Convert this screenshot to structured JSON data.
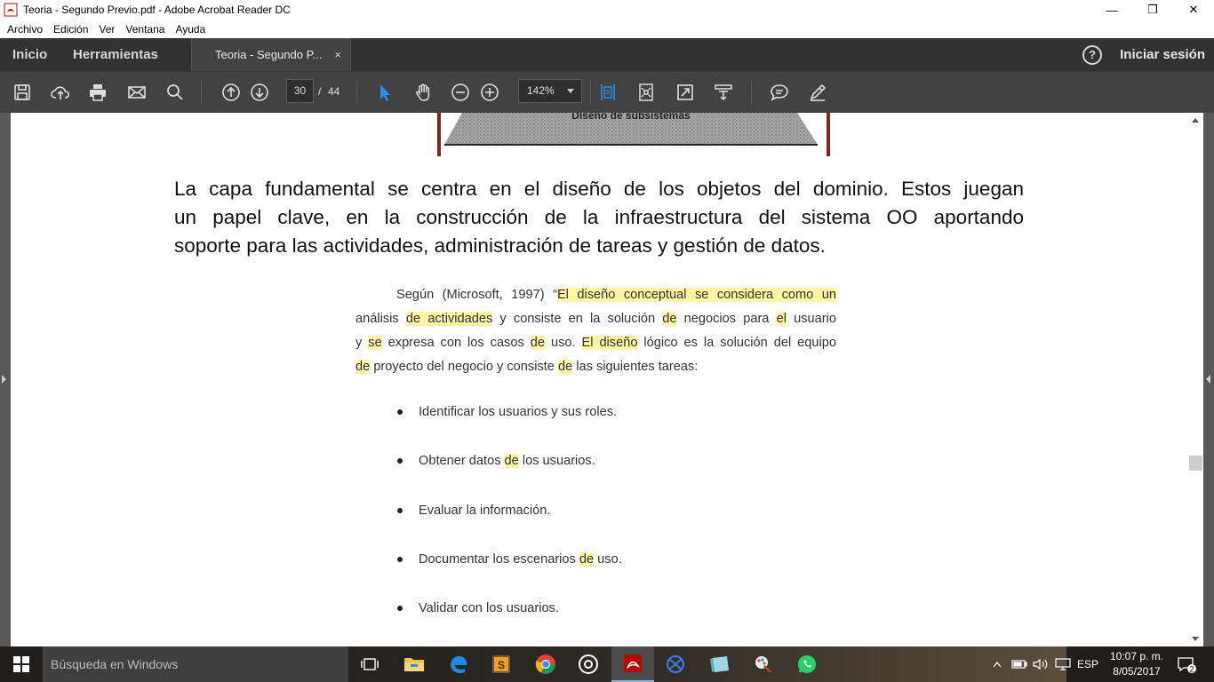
{
  "window": {
    "title": "Teoria - Segundo Previo.pdf - Adobe Acrobat Reader DC",
    "minimize_glyph": "—",
    "maximize_glyph": "❐",
    "close_glyph": "✕"
  },
  "menubar": [
    "Archivo",
    "Edición",
    "Ver",
    "Ventana",
    "Ayuda"
  ],
  "tabs": {
    "home": "Inicio",
    "tools": "Herramientas",
    "document": "Teoria - Segundo P...",
    "document_close": "×",
    "help": "?",
    "signin": "Iniciar sesión"
  },
  "toolbar": {
    "page_current": "30",
    "page_separator": "/",
    "page_total": "44",
    "zoom": "142%",
    "icons": [
      "save-icon",
      "upload-cloud-icon",
      "print-icon",
      "mail-icon",
      "search-icon",
      "page-up-icon",
      "page-down-icon",
      "select-cursor-icon",
      "hand-tool-icon",
      "zoom-out-icon",
      "zoom-in-icon",
      "fit-page-icon",
      "full-screen-icon",
      "expand-icon",
      "read-mode-icon",
      "comment-icon",
      "highlight-pen-icon"
    ]
  },
  "document": {
    "figure_caption": "Diseño de subsistemas",
    "main_paragraph": [
      "La capa fundamental  se centra en el diseño de los objetos del dominio. Estos juegan",
      "un  papel  clave,  en  la  construcción  de  la  infraestructura   del  sistema  OO  aportando",
      "soporte para las actividades, administración de tareas y gestión de datos."
    ],
    "scan_paragraph": {
      "l1_a": "Según  (Microsoft, 1997)  “",
      "l1_b": "El diseño conceptual se considera como un",
      "l2_a": "análisis ",
      "l2_b": "de actividades",
      "l2_c": " y consiste en la solución ",
      "l2_d": "de",
      "l2_e": " negocios para ",
      "l2_f": "el",
      "l2_g": " usuario",
      "l3_a": "y ",
      "l3_b": "se",
      "l3_c": " expresa con los casos ",
      "l3_d": "de",
      "l3_e": " uso. ",
      "l3_f": "El diseño",
      "l3_g": " lógico es la solución del equipo",
      "l4_a": "de",
      "l4_b": " proyecto del negocio y consiste ",
      "l4_c": "de",
      "l4_d": " las siguientes tareas:"
    },
    "bullets": [
      {
        "a": "Identificar los usuarios y sus roles.",
        "hl": "",
        "b": ""
      },
      {
        "a": "Obtener datos ",
        "hl": "de",
        "b": " los usuarios."
      },
      {
        "a": "Evaluar la información.",
        "hl": "",
        "b": ""
      },
      {
        "a": "Documentar los escenarios ",
        "hl": "de",
        "b": " uso."
      },
      {
        "a": "Validar con los usuarios.",
        "hl": "",
        "b": ""
      }
    ]
  },
  "taskbar": {
    "search_placeholder": "Búsqueda en Windows",
    "apps": [
      "task-view-icon",
      "file-explorer-icon",
      "edge-icon",
      "sublime-icon",
      "chrome-icon",
      "obs-icon",
      "acrobat-icon",
      "network-app-icon",
      "storage-app-icon",
      "paint-app-icon",
      "whatsapp-icon"
    ],
    "language": "ESP",
    "time": "10:07 p. m.",
    "date": "8/05/2017",
    "notifications": "2"
  },
  "colors": {
    "highlight": "#fff3a6",
    "toolbar_bg": "#424242",
    "tabbar_bg": "#323232",
    "select_tool_blue": "#2d8ceb"
  }
}
